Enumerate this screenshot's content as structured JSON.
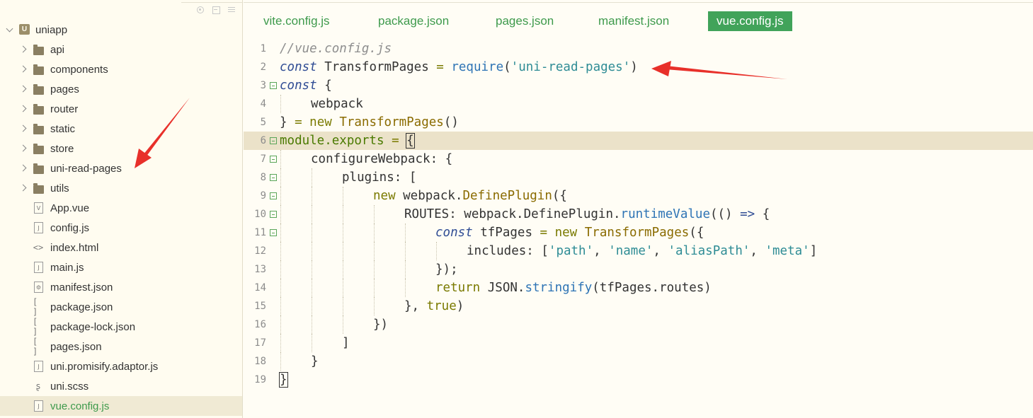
{
  "sidebar": {
    "root": {
      "label": "uniapp",
      "icon": "uniapp-project-icon",
      "badge": "U"
    },
    "folders": [
      {
        "label": "api",
        "icon": "folder-icon"
      },
      {
        "label": "components",
        "icon": "folder-icon"
      },
      {
        "label": "pages",
        "icon": "folder-icon"
      },
      {
        "label": "router",
        "icon": "folder-icon"
      },
      {
        "label": "static",
        "icon": "folder-icon"
      },
      {
        "label": "store",
        "icon": "folder-icon"
      },
      {
        "label": "uni-read-pages",
        "icon": "folder-icon"
      },
      {
        "label": "utils",
        "icon": "folder-icon"
      }
    ],
    "files": [
      {
        "label": "App.vue",
        "icon": "vue-file-icon",
        "glyph": "V"
      },
      {
        "label": "config.js",
        "icon": "js-file-icon",
        "glyph": "J"
      },
      {
        "label": "index.html",
        "icon": "html-file-icon",
        "glyph": "<>"
      },
      {
        "label": "main.js",
        "icon": "js-file-icon",
        "glyph": "J"
      },
      {
        "label": "manifest.json",
        "icon": "manifest-file-icon",
        "glyph": "⚙"
      },
      {
        "label": "package.json",
        "icon": "json-file-icon",
        "glyph": "[ ]"
      },
      {
        "label": "package-lock.json",
        "icon": "json-file-icon",
        "glyph": "[ ]"
      },
      {
        "label": "pages.json",
        "icon": "json-file-icon",
        "glyph": "[ ]"
      },
      {
        "label": "uni.promisify.adaptor.js",
        "icon": "js-file-icon",
        "glyph": "J"
      },
      {
        "label": "uni.scss",
        "icon": "scss-file-icon",
        "glyph": "ʂ"
      },
      {
        "label": "vue.config.js",
        "icon": "js-file-icon",
        "glyph": "J",
        "active": true
      }
    ]
  },
  "tabs": [
    {
      "label": "vite.config.js",
      "active": false
    },
    {
      "label": "package.json",
      "active": false
    },
    {
      "label": "pages.json",
      "active": false
    },
    {
      "label": "manifest.json",
      "active": false
    },
    {
      "label": "vue.config.js",
      "active": true
    }
  ],
  "code": {
    "current_line": 6,
    "lines": [
      {
        "n": "1",
        "fold": false,
        "indent": 0,
        "tokens": [
          [
            "c",
            "//vue.config.js"
          ]
        ]
      },
      {
        "n": "2",
        "fold": false,
        "indent": 0,
        "tokens": [
          [
            "k",
            "const"
          ],
          [
            "p",
            " TransformPages "
          ],
          [
            "n",
            "="
          ],
          [
            "p",
            " "
          ],
          [
            "f",
            "require"
          ],
          [
            "p",
            "("
          ],
          [
            "s",
            "'uni-read-pages'"
          ],
          [
            "p",
            ")"
          ]
        ]
      },
      {
        "n": "3",
        "fold": true,
        "indent": 0,
        "tokens": [
          [
            "k",
            "const"
          ],
          [
            "p",
            " {"
          ]
        ]
      },
      {
        "n": "4",
        "fold": false,
        "indent": 1,
        "tokens": [
          [
            "p",
            "webpack"
          ]
        ]
      },
      {
        "n": "5",
        "fold": false,
        "indent": 0,
        "tokens": [
          [
            "p",
            "} "
          ],
          [
            "n",
            "="
          ],
          [
            "p",
            " "
          ],
          [
            "kb",
            "new"
          ],
          [
            "p",
            " "
          ],
          [
            "cl",
            "TransformPages"
          ],
          [
            "p",
            "()"
          ]
        ]
      },
      {
        "n": "6",
        "fold": true,
        "indent": 0,
        "tokens": [
          [
            "m",
            "module.exports"
          ],
          [
            "p",
            " "
          ],
          [
            "n",
            "="
          ],
          [
            "p",
            " "
          ],
          [
            "cur",
            "{"
          ]
        ]
      },
      {
        "n": "7",
        "fold": true,
        "indent": 1,
        "tokens": [
          [
            "p",
            "configureWebpack: {"
          ]
        ]
      },
      {
        "n": "8",
        "fold": true,
        "indent": 2,
        "tokens": [
          [
            "p",
            "plugins: ["
          ]
        ]
      },
      {
        "n": "9",
        "fold": true,
        "indent": 3,
        "tokens": [
          [
            "kb",
            "new"
          ],
          [
            "p",
            " webpack."
          ],
          [
            "cl",
            "DefinePlugin"
          ],
          [
            "p",
            "({"
          ]
        ]
      },
      {
        "n": "10",
        "fold": true,
        "indent": 4,
        "tokens": [
          [
            "p",
            "ROUTES: webpack.DefinePlugin."
          ],
          [
            "f",
            "runtimeValue"
          ],
          [
            "p",
            "(() "
          ],
          [
            "k",
            "=>"
          ],
          [
            "p",
            " {"
          ]
        ]
      },
      {
        "n": "11",
        "fold": true,
        "indent": 5,
        "tokens": [
          [
            "k",
            "const"
          ],
          [
            "p",
            " tfPages "
          ],
          [
            "n",
            "="
          ],
          [
            "p",
            " "
          ],
          [
            "kb",
            "new"
          ],
          [
            "p",
            " "
          ],
          [
            "cl",
            "TransformPages"
          ],
          [
            "p",
            "({"
          ]
        ]
      },
      {
        "n": "12",
        "fold": false,
        "indent": 6,
        "tokens": [
          [
            "p",
            "includes: ["
          ],
          [
            "s",
            "'path'"
          ],
          [
            "p",
            ", "
          ],
          [
            "s",
            "'name'"
          ],
          [
            "p",
            ", "
          ],
          [
            "s",
            "'aliasPath'"
          ],
          [
            "p",
            ", "
          ],
          [
            "s",
            "'meta'"
          ],
          [
            "p",
            "]"
          ]
        ]
      },
      {
        "n": "13",
        "fold": false,
        "indent": 5,
        "tokens": [
          [
            "p",
            "});"
          ]
        ]
      },
      {
        "n": "14",
        "fold": false,
        "indent": 5,
        "tokens": [
          [
            "kb",
            "return"
          ],
          [
            "p",
            " JSON."
          ],
          [
            "f",
            "stringify"
          ],
          [
            "p",
            "(tfPages.routes)"
          ]
        ]
      },
      {
        "n": "15",
        "fold": false,
        "indent": 4,
        "tokens": [
          [
            "p",
            "}, "
          ],
          [
            "b",
            "true"
          ],
          [
            "p",
            ")"
          ]
        ]
      },
      {
        "n": "16",
        "fold": false,
        "indent": 3,
        "tokens": [
          [
            "p",
            "})"
          ]
        ]
      },
      {
        "n": "17",
        "fold": false,
        "indent": 2,
        "tokens": [
          [
            "p",
            "]"
          ]
        ]
      },
      {
        "n": "18",
        "fold": false,
        "indent": 1,
        "tokens": [
          [
            "p",
            "}"
          ]
        ]
      },
      {
        "n": "19",
        "fold": false,
        "indent": 0,
        "tokens": [
          [
            "cur",
            "}"
          ]
        ]
      }
    ]
  },
  "colors": {
    "accent": "#41a35a",
    "annotation_arrow": "#e8302a",
    "current_line": "#ebe2c9"
  }
}
